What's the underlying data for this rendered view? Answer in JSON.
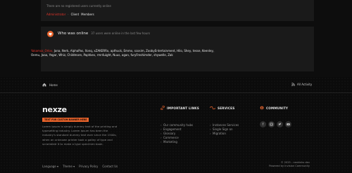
{
  "stats_panel": {
    "no_users_text": "There are no registered users currently online",
    "legend": {
      "administrator": "Administrator",
      "client": "Client",
      "members": "Members"
    }
  },
  "online_panel": {
    "title": "Who was online",
    "subtitle": "37 users were online in the last few hours",
    "users_line1": [
      "Yakamoz_Orlov, ",
      "Jana, Nerk, ",
      "AlphaPas, ",
      "Xonq, ",
      "xZAKERRx, ",
      "apthuck, Emmx, ",
      "scosim, ",
      "ZoobyEntertainment, ",
      "Hilo, ",
      "Shey, ",
      "tesse, ",
      "Keenley,"
    ],
    "users_line2": "Oemu, Jaaa, Yegar, Whiz, Childmore, Paphkev, rmr4uight, Nuus, agan, furyFreshimder, shywelle, Zak"
  },
  "footer_bar": {
    "home_label": "Home",
    "all_activity_label": "All Activity"
  },
  "brand": {
    "logo_text": "nexze",
    "badge_text": "TEXT FOR CUSTOM BANNER HERE",
    "description": "Lorem Ipsum is simply dummy text of the printing and typesetting industry. Lorem Ipsum has been the industry's standard dummy text ever since the 1500s, when an unknown printer took a galley of type and scrambled it to make a type specimen book."
  },
  "columns": {
    "important_links": {
      "title": "IMPORTANT LINKS",
      "items": [
        "Our community hubs",
        "Engagement",
        "Glossary",
        "Commerce",
        "Marketing"
      ]
    },
    "services": {
      "title": "SERVICES",
      "items": [
        "Instances Services",
        "Single Sign on",
        "Migration"
      ]
    },
    "community": {
      "title": "COMMUNITY",
      "socials": [
        "facebook-icon",
        "instagram-icon",
        "twitter-icon",
        "youtube-icon"
      ]
    }
  },
  "bottom_bar": {
    "language": "Language",
    "theme": "Theme",
    "privacy": "Privacy Policy",
    "contact": "Contact Us",
    "copyright": "© 2025 - nexkinks dev",
    "powered": "Powered by Invision Community"
  },
  "colors": {
    "accent": "#e8632b",
    "admin_red": "#e8352b"
  }
}
